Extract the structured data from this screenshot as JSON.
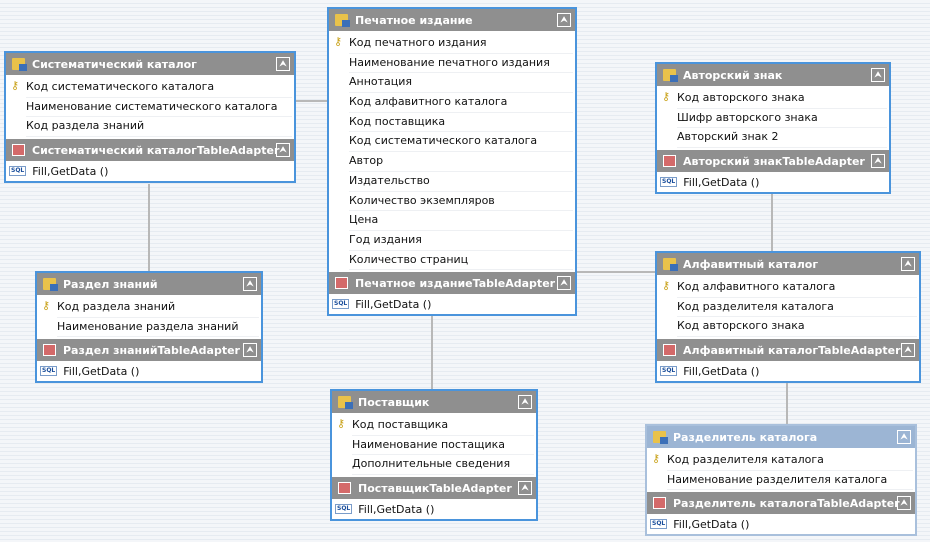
{
  "tables": [
    {
      "id": "sys",
      "title": "Систематический каталог",
      "adapter": "Систематический каталогTableAdapter",
      "rows": [
        "Код систематического каталога",
        "Наименование систематического каталога",
        "Код раздела знаний"
      ],
      "method": "Fill,GetData ()"
    },
    {
      "id": "razdel",
      "title": "Раздел знаний",
      "adapter": "Раздел знанийTableAdapter",
      "rows": [
        "Код раздела знаний",
        "Наименование раздела знаний"
      ],
      "method": "Fill,GetData ()"
    },
    {
      "id": "pech",
      "title": "Печатное издание",
      "adapter": "Печатное изданиеTableAdapter",
      "rows": [
        "Код печатного издания",
        "Наименование печатного издания",
        "Аннотация",
        "Код алфавитного каталога",
        "Код поставщика",
        "Код систематического каталога",
        "Автор",
        "Издательство",
        "Количество экземпляров",
        "Цена",
        "Год издания",
        "Количество страниц"
      ],
      "method": "Fill,GetData ()"
    },
    {
      "id": "post",
      "title": "Поставщик",
      "adapter": "ПоставщикTableAdapter",
      "rows": [
        "Код поставщика",
        "Наименование постащика",
        "Дополнительные сведения"
      ],
      "method": "Fill,GetData ()"
    },
    {
      "id": "avt",
      "title": "Авторский знак",
      "adapter": "Авторский знакTableAdapter",
      "rows": [
        "Код авторского знака",
        "Шифр авторского знака",
        "Авторский знак 2"
      ],
      "method": "Fill,GetData ()"
    },
    {
      "id": "alf",
      "title": "Алфавитный каталог",
      "adapter": "Алфавитный каталогTableAdapter",
      "rows": [
        "Код алфавитного каталога",
        "Код разделителя каталога",
        "Код авторского знака"
      ],
      "method": "Fill,GetData ()"
    },
    {
      "id": "razd",
      "title": "Разделитель каталога",
      "adapter": "Разделитель каталогаTableAdapter",
      "rows": [
        "Код разделителя каталога",
        "Наименование разделителя каталога"
      ],
      "method": "Fill,GetData ()",
      "selected": true
    }
  ],
  "collapse_glyph": "⮝"
}
